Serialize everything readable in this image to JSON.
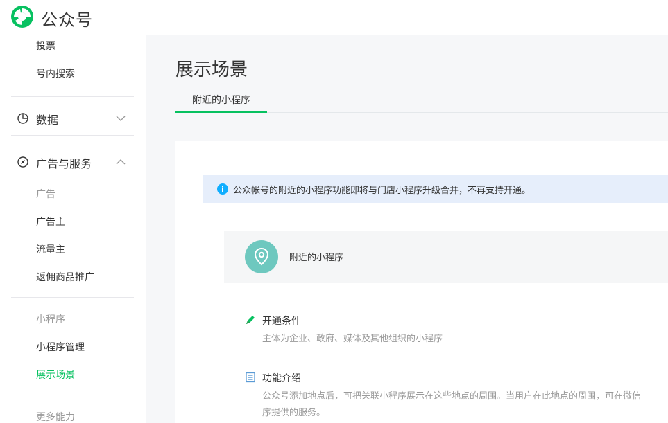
{
  "header": {
    "brand": "公众号"
  },
  "sidebar": {
    "top_items": [
      "投票",
      "号内搜索"
    ],
    "data_menu": {
      "label": "数据",
      "icon": "pie-chart-icon"
    },
    "ads_menu": {
      "label": "广告与服务",
      "icon": "compass-icon"
    },
    "ads_group_label": "广告",
    "ads_items": [
      "广告主",
      "流量主",
      "返佣商品推广"
    ],
    "mini_group_label": "小程序",
    "mini_items": [
      "小程序管理",
      "展示场景"
    ],
    "more_label": "更多能力"
  },
  "main": {
    "title": "展示场景",
    "tabs": [
      {
        "label": "附近的小程序"
      }
    ],
    "notice": "公众帐号的附近的小程序功能即将与门店小程序升级合并，不再支持开通。",
    "card_label": "附近的小程序",
    "conditions": {
      "title": "开通条件",
      "desc": "主体为企业、政府、媒体及其他组织的小程序"
    },
    "intro": {
      "title": "功能介绍",
      "desc_line1": "公众号添加地点后，可把关联小程序展示在这些地点的周围。当用户在此地点的周围，可在微信",
      "desc_line2": "序提供的服务。"
    }
  },
  "colors": {
    "accent": "#07c160",
    "notice_bg": "#e6eefb",
    "pin_bg": "#6ec8bf",
    "info_blue": "#10aeff"
  }
}
